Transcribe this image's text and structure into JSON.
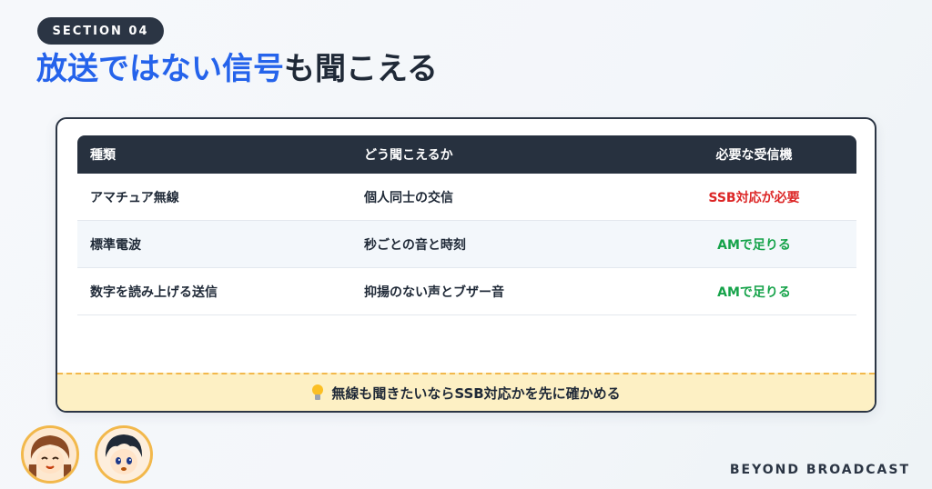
{
  "section_label": "SECTION 04",
  "title": {
    "accent": "放送ではない信号",
    "rest": "も聞こえる"
  },
  "table": {
    "headers": [
      "種類",
      "どう聞こえるか",
      "必要な受信機"
    ],
    "rows": [
      {
        "type": "アマチュア無線",
        "how": "個人同士の交信",
        "receiver": "SSB対応が必要",
        "receiver_status": "required"
      },
      {
        "type": "標準電波",
        "how": "秒ごとの音と時刻",
        "receiver": "AMで足りる",
        "receiver_status": "ok"
      },
      {
        "type": "数字を読み上げる送信",
        "how": "抑揚のない声とブザー音",
        "receiver": "AMで足りる",
        "receiver_status": "ok"
      }
    ]
  },
  "tip": {
    "icon": "lightbulb-icon",
    "text": "無線も聞きたいならSSB対応かを先に確かめる"
  },
  "brand": "BEYOND BROADCAST",
  "colors": {
    "accent": "#2563eb",
    "dark": "#2b3544",
    "required": "#dc2626",
    "ok": "#16a34a",
    "tip_bg": "#fdf0c4"
  }
}
